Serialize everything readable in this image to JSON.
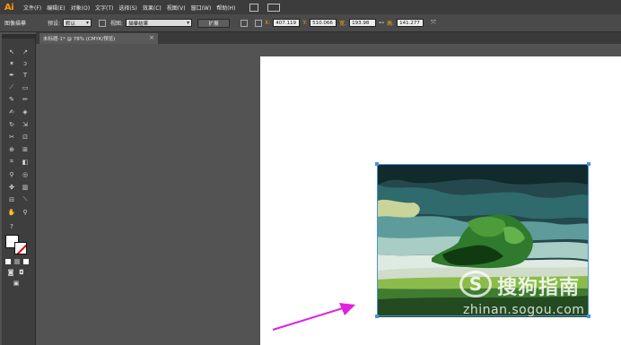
{
  "app": {
    "logo": "Ai"
  },
  "menu": [
    "文件(F)",
    "编辑(E)",
    "对象(O)",
    "文字(T)",
    "选择(S)",
    "效果(C)",
    "视图(V)",
    "窗口(W)",
    "帮助(H)"
  ],
  "control_bar": {
    "panel_label": "图像描摹",
    "preset_label": "预设:",
    "preset_value": "默认",
    "view_label": "视图:",
    "view_value": "描摹结果",
    "expand_button": "扩展",
    "x_label": "X:",
    "x_value": "407.119",
    "y_label": "Y:",
    "y_value": "510.066",
    "w_label": "宽:",
    "w_value": "193.98",
    "h_label": "高:",
    "h_value": "141.277"
  },
  "document_tab": {
    "title": "未标题-1* @ 78% (CMYK/预览)",
    "close": "×"
  },
  "toolbox": {
    "tools": [
      "selection",
      "direct-selection",
      "magic-wand",
      "lasso",
      "pen",
      "type",
      "line",
      "rectangle",
      "paintbrush",
      "pencil",
      "blob-brush",
      "eraser",
      "rotate",
      "scale",
      "width",
      "free-transform",
      "shape-builder",
      "perspective",
      "mesh",
      "gradient",
      "eyedropper",
      "blend",
      "symbol-sprayer",
      "column-graph",
      "artboard",
      "slice",
      "hand",
      "zoom"
    ]
  },
  "colors": {
    "accent": "#4a90e2",
    "arrow": "#e020e0",
    "logo": "#ff9a00"
  },
  "watermark": {
    "logo": "S",
    "title": "搜狗指南",
    "url": "zhinan.sogou.com"
  }
}
